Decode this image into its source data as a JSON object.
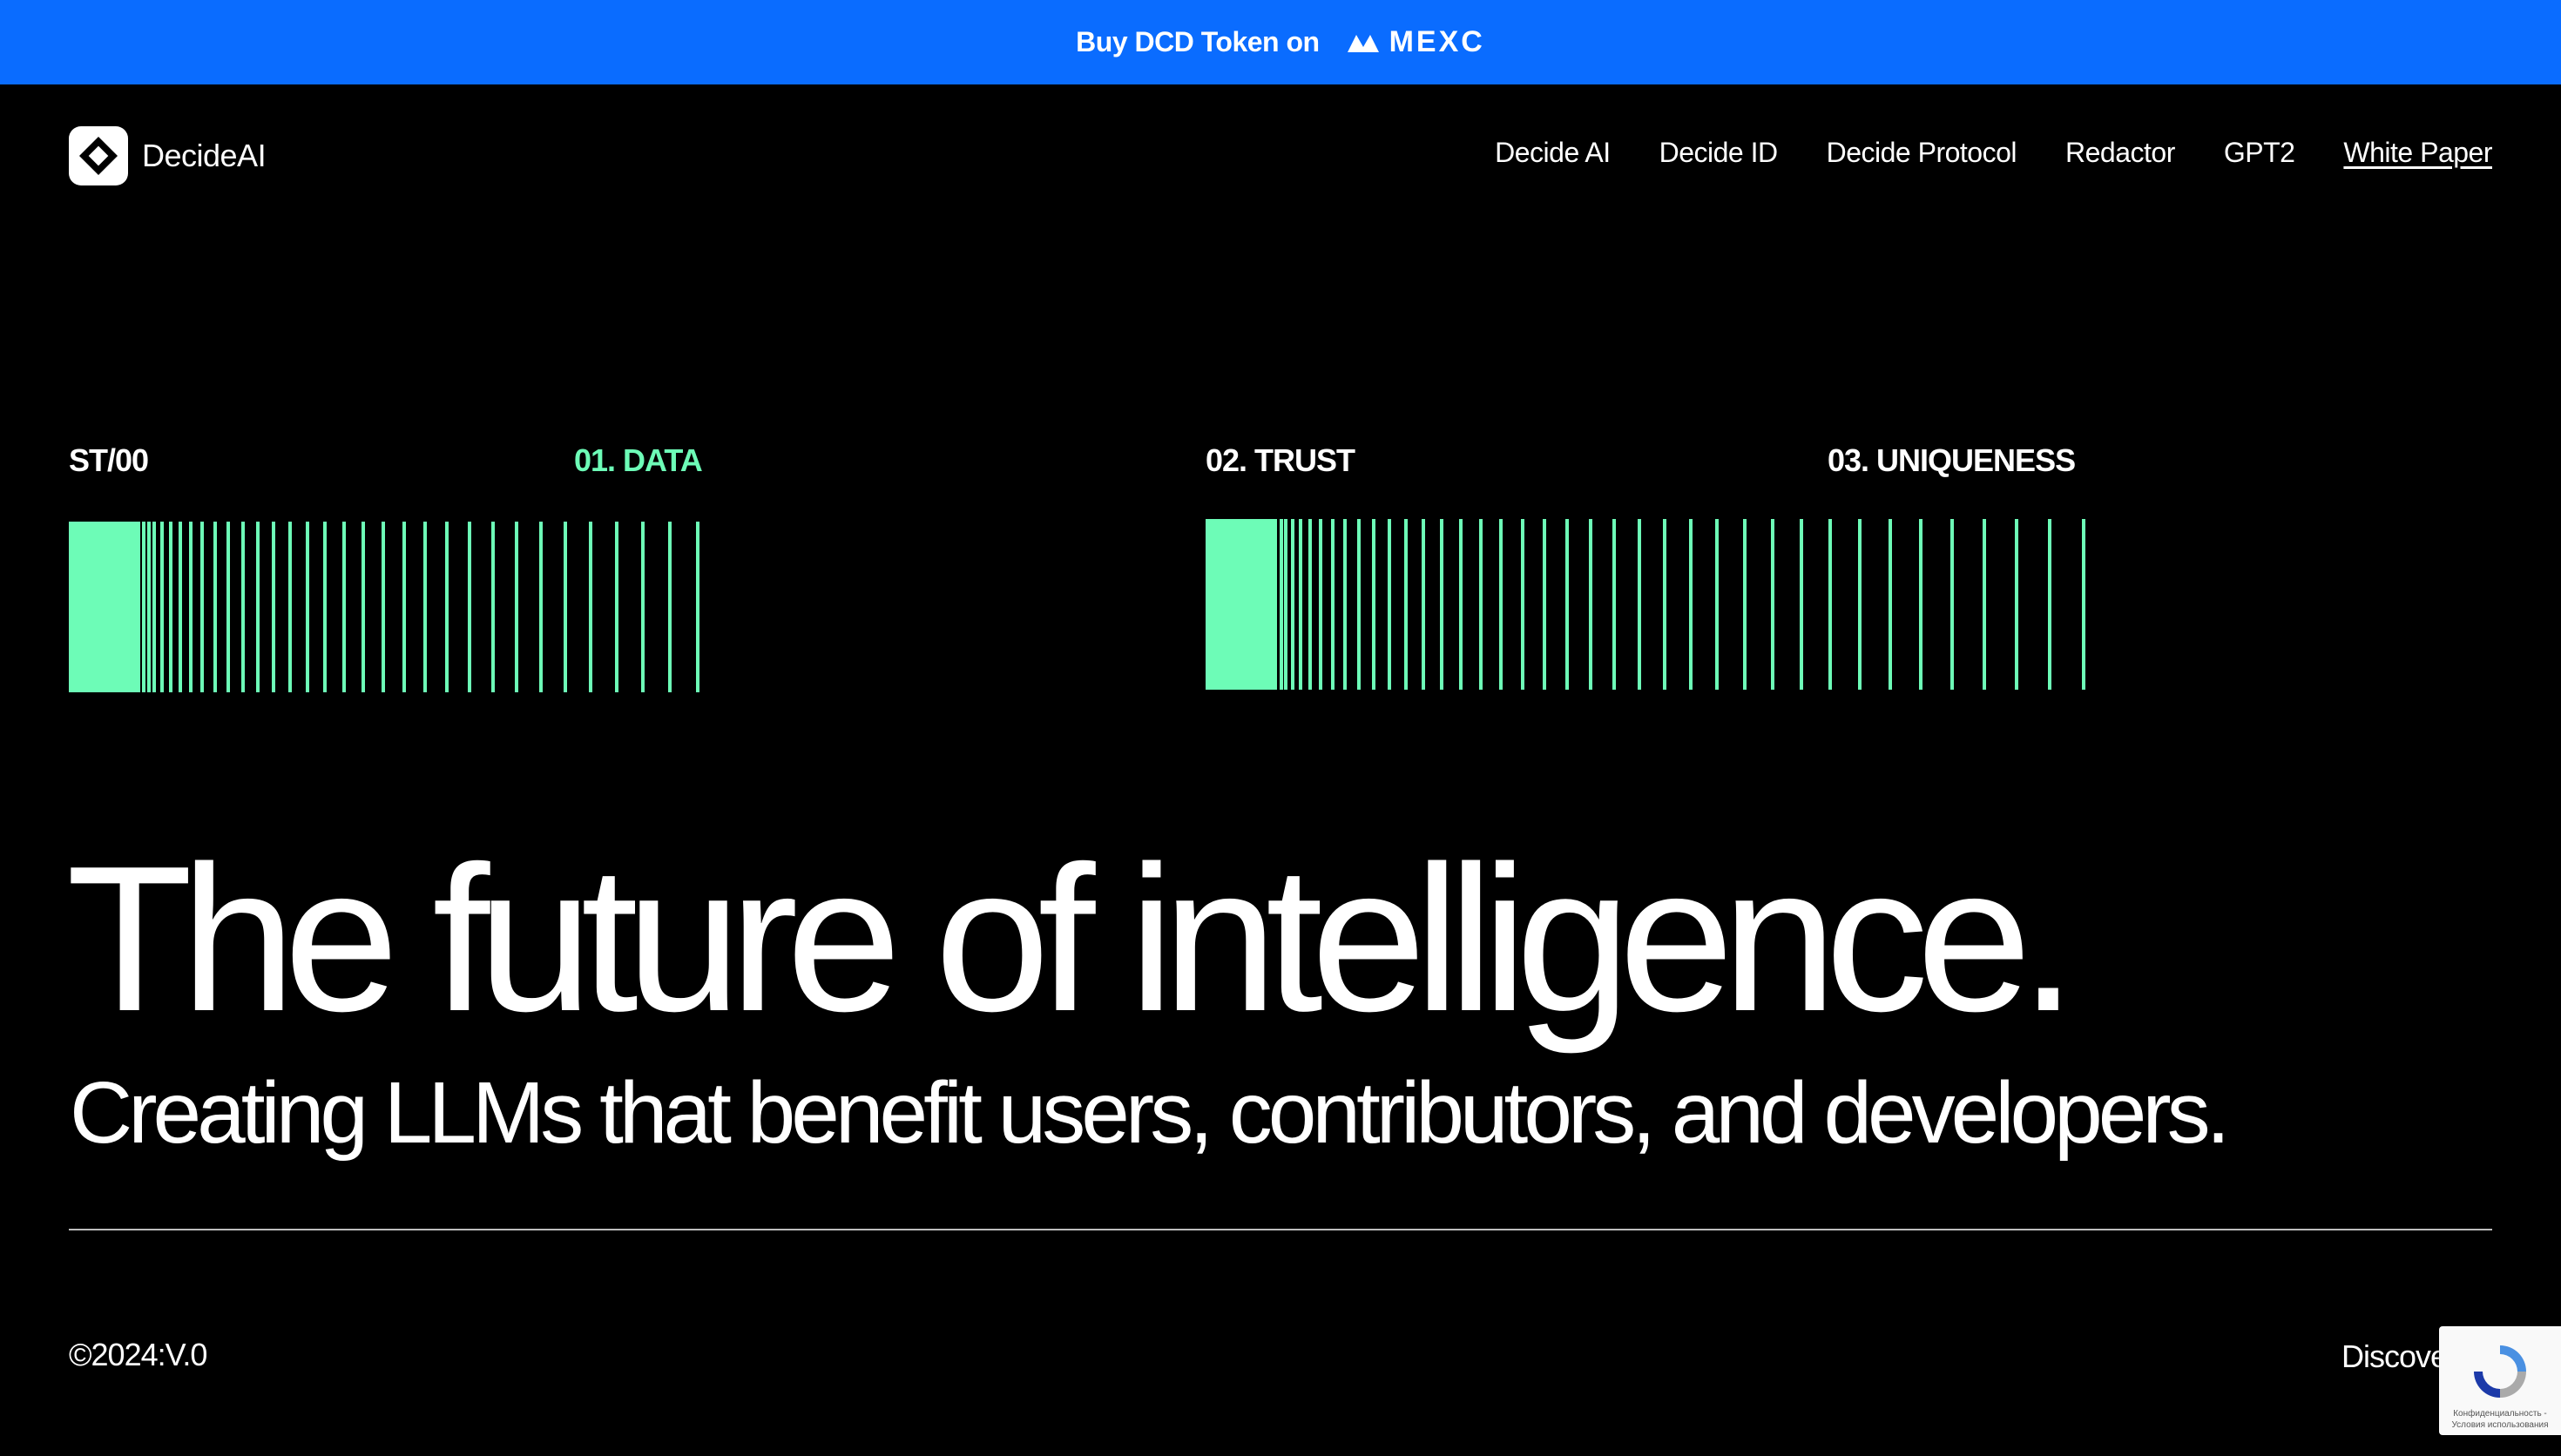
{
  "banner": {
    "text": "Buy DCD Token on",
    "exchange": "MEXC",
    "exchange_icon": "mexc-logo-icon",
    "color": "#0a6cff"
  },
  "nav": {
    "logo_text": "DecideAI",
    "items": [
      {
        "label": "Decide AI"
      },
      {
        "label": "Decide ID"
      },
      {
        "label": "Decide Protocol"
      },
      {
        "label": "Redactor"
      },
      {
        "label": "GPT2"
      },
      {
        "label": "White Paper"
      }
    ]
  },
  "stages": {
    "current": "ST/00",
    "labels": [
      "01. DATA",
      "02. TRUST",
      "03. UNIQUENESS"
    ],
    "accent": "#6dfcb7"
  },
  "hero": {
    "headline": "The future of intelligence.",
    "subline": "Creating LLMs that benefit users, contributors, and developers."
  },
  "footer": {
    "copyright": "©2024:V.0",
    "discover": "Discover"
  },
  "recaptcha": {
    "icon": "recaptcha-icon",
    "text_line1": "Конфиденциальность -",
    "text_line2": "Условия использования"
  }
}
